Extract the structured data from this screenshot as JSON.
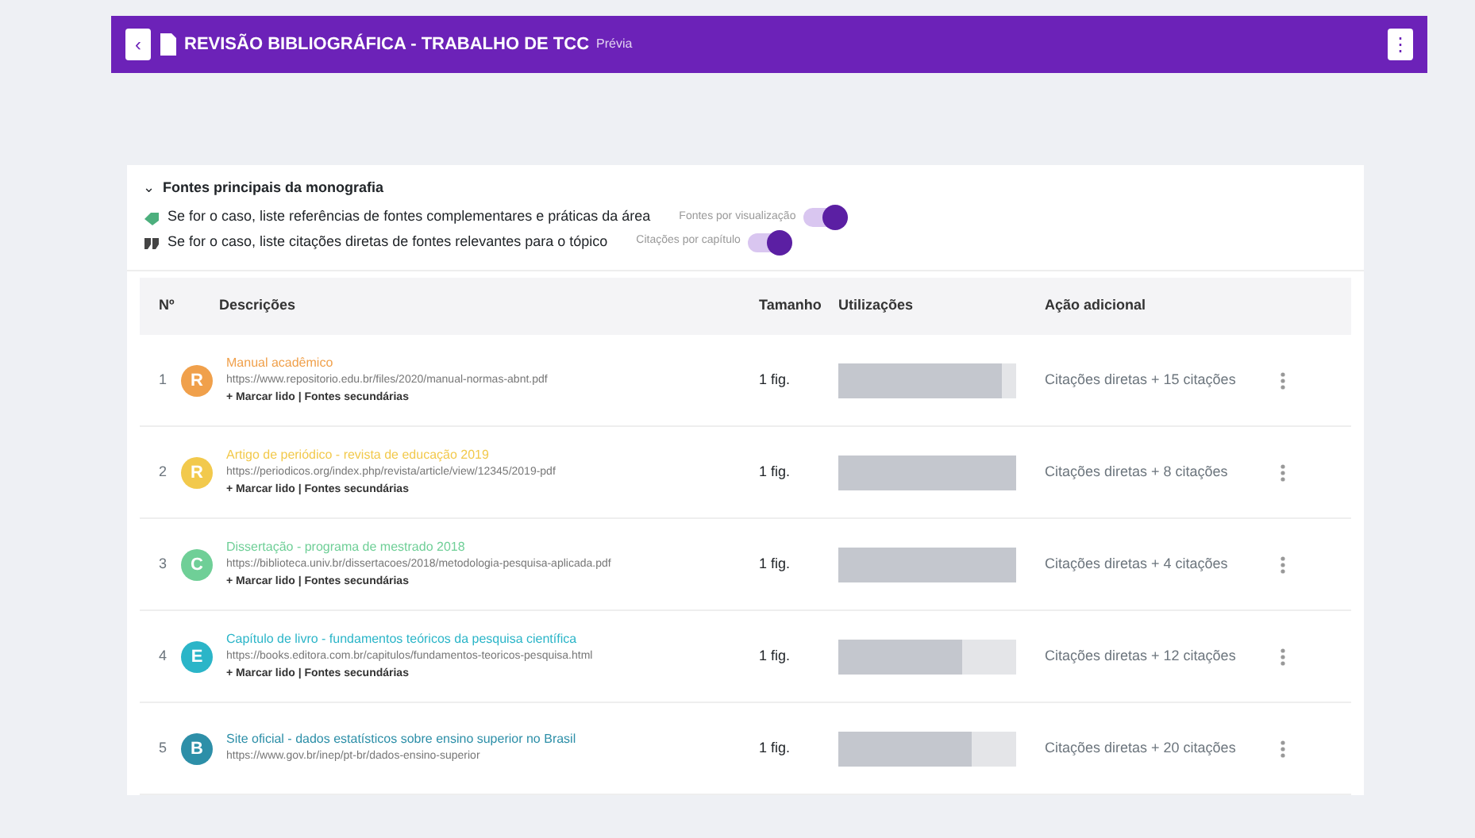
{
  "header": {
    "back": "‹",
    "title": "REVISÃO BIBLIOGRÁFICA - TRABALHO DE TCC",
    "subtitle": "Prévia",
    "menu": "⋮"
  },
  "section": {
    "caret": "⌄",
    "title": "Fontes principais da monografia",
    "toggles": [
      {
        "kind": "link",
        "text": "Se for o caso, liste referências de fontes complementares e práticas da área",
        "hint": "Fontes por visualização",
        "on": true
      },
      {
        "kind": "quote",
        "text": "Se for o caso, liste citações diretas de fontes relevantes para o tópico",
        "hint": "Citações por capítulo",
        "on": true
      }
    ]
  },
  "table": {
    "columns": [
      "Nº",
      "Descrições",
      "Tamanho",
      "Utilizações",
      "Ação adicional"
    ],
    "rows": [
      {
        "num": "1",
        "letter": "R",
        "color": "#f0a04b",
        "title": "Manual acadêmico",
        "url": "https://www.repositorio.edu.br/files/2020/manual-normas-abnt.pdf",
        "note": "+ Marcar lido | Fontes secundárias",
        "size": "1 fig.",
        "level": 0.92,
        "action": "Citações diretas + 15 citações"
      },
      {
        "num": "2",
        "letter": "R",
        "color": "#f2c94c",
        "title": "Artigo de periódico - revista de educação 2019",
        "url": "https://periodicos.org/index.php/revista/article/view/12345/2019-pdf",
        "note": "+ Marcar lido | Fontes secundárias",
        "size": "1 fig.",
        "level": 1,
        "action": "Citações diretas + 8 citações"
      },
      {
        "num": "3",
        "letter": "C",
        "color": "#6fcf97",
        "title": "Dissertação - programa de mestrado 2018",
        "url": "https://biblioteca.univ.br/dissertacoes/2018/metodologia-pesquisa-aplicada.pdf",
        "note": "+ Marcar lido | Fontes secundárias",
        "size": "1 fig.",
        "level": 1,
        "action": "Citações diretas + 4 citações"
      },
      {
        "num": "4",
        "letter": "E",
        "color": "#2bb5c8",
        "title": "Capítulo de livro - fundamentos teóricos da pesquisa científica",
        "url": "https://books.editora.com.br/capitulos/fundamentos-teoricos-pesquisa.html",
        "note": "+ Marcar lido | Fontes secundárias",
        "size": "1 fig.",
        "level": 0.7,
        "action": "Citações diretas + 12 citações"
      },
      {
        "num": "5",
        "letter": "B",
        "color": "#2d8fa8",
        "title": "Site oficial - dados estatísticos sobre ensino superior no Brasil",
        "url": "https://www.gov.br/inep/pt-br/dados-ensino-superior",
        "note": "",
        "size": "1 fig.",
        "level": 0.75,
        "action": "Citações diretas + 20 citações"
      }
    ]
  }
}
